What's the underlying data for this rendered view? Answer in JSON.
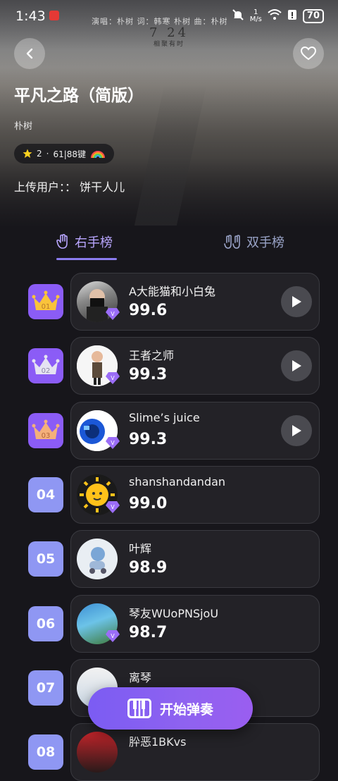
{
  "status_bar": {
    "time": "1:43",
    "network_speed": "1",
    "network_unit": "M/s",
    "battery": "70"
  },
  "header": {
    "credits": "演唱：朴树  词：韩寒 朴树  曲：朴树",
    "poster_date": "7 24",
    "poster_sub": "相聚有时",
    "song_title": "平凡之路（简版）",
    "artist": "朴树",
    "stars": "2",
    "key_info": "61|88键",
    "uploader_label": "上传用户：：",
    "uploader_name": "饼干人儿"
  },
  "tabs": [
    {
      "label": "右手榜",
      "active": true
    },
    {
      "label": "双手榜",
      "active": false
    }
  ],
  "leaderboard": [
    {
      "rank": "01",
      "name": "A大能猫和小白兔",
      "score": "99.6",
      "crown": true
    },
    {
      "rank": "02",
      "name": "王者之师",
      "score": "99.3",
      "crown": true
    },
    {
      "rank": "03",
      "name": "Slime’s juice",
      "score": "99.3",
      "crown": true
    },
    {
      "rank": "04",
      "name": "shanshandandan",
      "score": "99.0",
      "crown": false
    },
    {
      "rank": "05",
      "name": "叶辉",
      "score": "98.9",
      "crown": false
    },
    {
      "rank": "06",
      "name": "琴友WUoPNSjoU",
      "score": "98.7",
      "crown": false
    },
    {
      "rank": "07",
      "name": "离琴",
      "score": "",
      "crown": false
    },
    {
      "rank": "08",
      "name": "肸恶1BKvs",
      "score": "",
      "crown": false
    }
  ],
  "start_button": "开始弹奏",
  "colors": {
    "accent": "#8b5cf6",
    "rank_plain": "#8f97f3",
    "background": "#17161b",
    "card": "#232227"
  }
}
